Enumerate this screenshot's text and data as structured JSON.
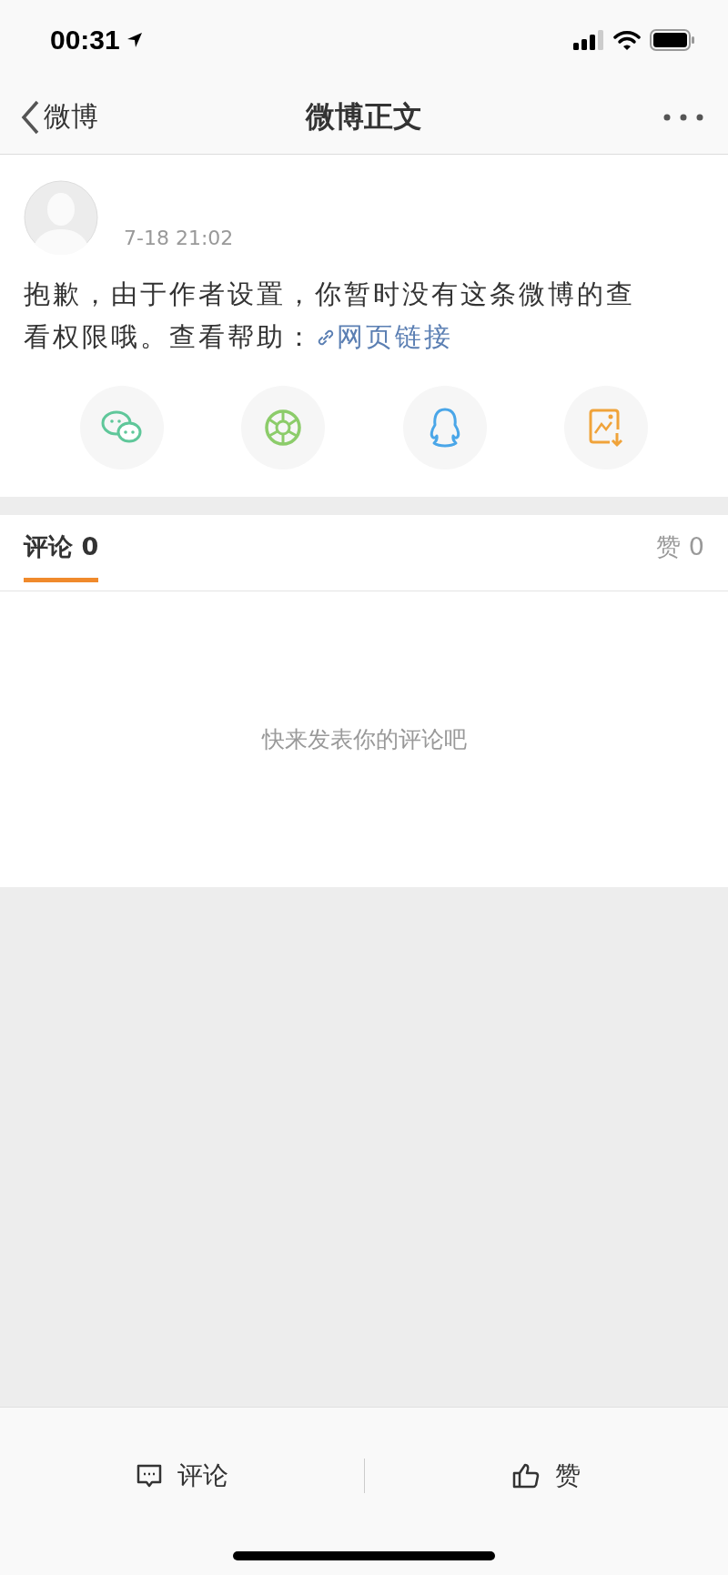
{
  "status_bar": {
    "time": "00:31"
  },
  "nav": {
    "back_label": "微博",
    "title": "微博正文"
  },
  "post": {
    "timestamp": "7-18 21:02",
    "text": "抱歉，由于作者设置，你暂时没有这条微博的查看权限哦。查看帮助：",
    "link": "网页链接"
  },
  "share_buttons": [
    {
      "kind": "wechat"
    },
    {
      "kind": "moments"
    },
    {
      "kind": "qq"
    },
    {
      "kind": "save"
    }
  ],
  "tabs": [
    {
      "label": "评论 0",
      "selected": true
    },
    {
      "label": "赞 0",
      "selected": false
    }
  ],
  "empty_message": "快来发表你的评论吧",
  "bottom_bar": [
    {
      "kind": "comment",
      "label": "评论"
    },
    {
      "kind": "like",
      "label": "赞"
    }
  ]
}
